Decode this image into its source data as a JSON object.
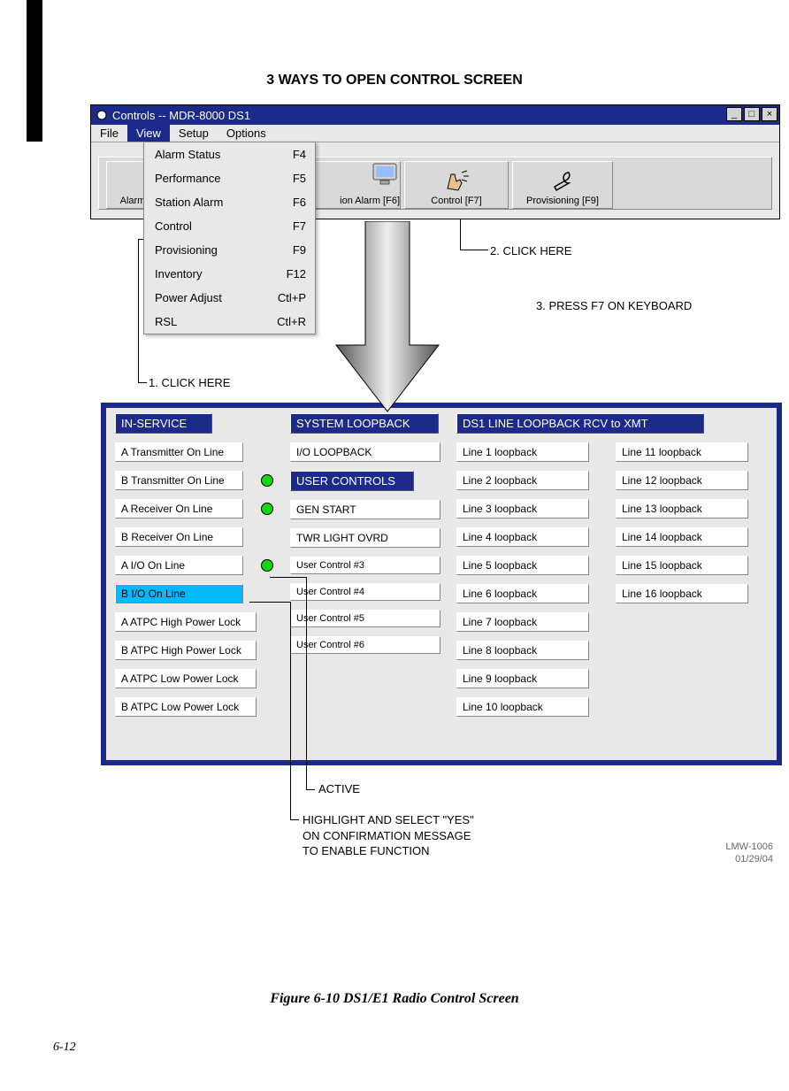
{
  "heading": "3 WAYS TO OPEN CONTROL SCREEN",
  "window": {
    "title": "Controls -- MDR-8000 DS1",
    "menu": {
      "file": "File",
      "view": "View",
      "setup": "Setup",
      "options": "Options"
    }
  },
  "toolbar": {
    "alarm_partial": "Alarm",
    "station_partial": "ion Alarm [F6]",
    "control": "Control [F7]",
    "prov": "Provisioning [F9]"
  },
  "dropdown": {
    "items": [
      {
        "label": "Alarm Status",
        "accel": "F4"
      },
      {
        "label": "Performance",
        "accel": "F5"
      },
      {
        "label": "Station Alarm",
        "accel": "F6"
      },
      {
        "label": "Control",
        "accel": "F7"
      },
      {
        "label": "Provisioning",
        "accel": "F9"
      },
      {
        "label": "Inventory",
        "accel": "F12"
      },
      {
        "label": "Power Adjust",
        "accel": "Ctl+P"
      },
      {
        "label": "RSL",
        "accel": "Ctl+R"
      }
    ]
  },
  "callouts": {
    "c1": "1. CLICK HERE",
    "c2": "2. CLICK HERE",
    "c3": "3. PRESS F7 ON KEYBOARD",
    "active": "ACTIVE",
    "highlight": "HIGHLIGHT AND SELECT \"YES\"\nON CONFIRMATION MESSAGE\nTO ENABLE FUNCTION"
  },
  "panels": {
    "inservice": {
      "title": "IN-SERVICE",
      "items": [
        "A Transmitter On Line",
        "B Transmitter On Line",
        "A Receiver On Line",
        "B Receiver On Line",
        "A I/O On Line",
        "B I/O On Line",
        "A ATPC High Power Lock",
        "B ATPC High Power Lock",
        "A ATPC Low Power Lock",
        "B ATPC Low Power Lock"
      ]
    },
    "system": {
      "title": "SYSTEM LOOPBACK",
      "io": "I/O LOOPBACK",
      "user_title": "USER CONTROLS",
      "items": [
        "GEN START",
        "TWR LIGHT OVRD",
        "User Control #3",
        "User Control #4",
        "User Control #5",
        "User Control #6"
      ]
    },
    "ds1": {
      "title": "DS1 LINE LOOPBACK RCV to XMT",
      "left": [
        "Line 1 loopback",
        "Line 2 loopback",
        "Line 3 loopback",
        "Line 4 loopback",
        "Line 5 loopback",
        "Line 6 loopback",
        "Line 7 loopback",
        "Line 8 loopback",
        "Line 9 loopback",
        "Line 10 loopback"
      ],
      "right": [
        "Line 11 loopback",
        "Line 12 loopback",
        "Line 13 loopback",
        "Line 14 loopback",
        "Line 15 loopback",
        "Line 16 loopback"
      ]
    }
  },
  "doc": {
    "id": "LMW-1006",
    "date": "01/29/04"
  },
  "figure": "Figure 6-10  DS1/E1 Radio Control Screen",
  "page": "6-12"
}
